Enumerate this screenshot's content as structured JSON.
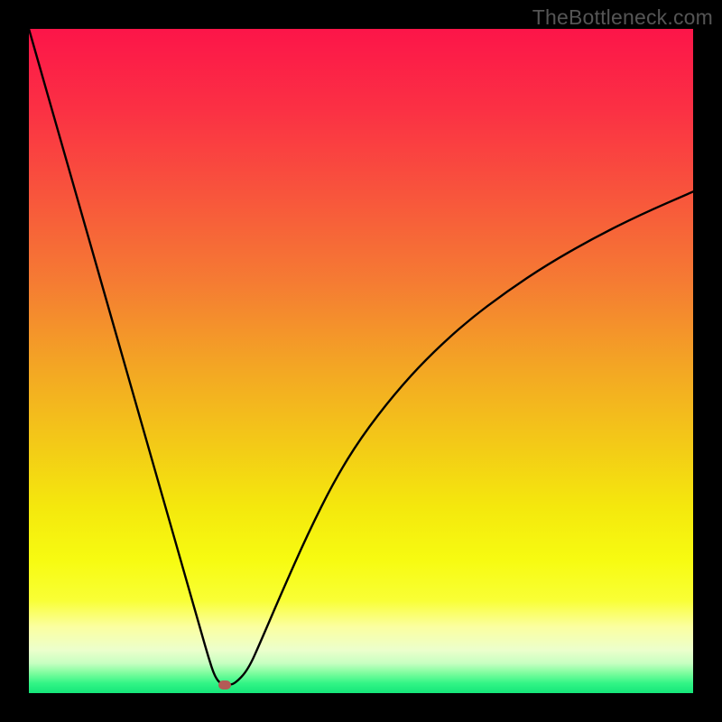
{
  "attribution": "TheBottleneck.com",
  "chart_data": {
    "type": "line",
    "title": "",
    "xlabel": "",
    "ylabel": "",
    "xlim": [
      0,
      100
    ],
    "ylim": [
      0,
      100
    ],
    "grid": false,
    "legend": false,
    "annotations": [],
    "series": [
      {
        "name": "bottleneck-curve",
        "x": [
          0,
          2,
          4,
          6,
          8,
          10,
          12,
          14,
          16,
          18,
          20,
          22,
          24,
          26,
          27,
          28,
          29,
          30,
          31,
          33,
          35,
          38,
          42,
          46,
          50,
          55,
          60,
          66,
          72,
          78,
          85,
          92,
          100
        ],
        "values": [
          100,
          93,
          86,
          79,
          72,
          65,
          58,
          51,
          44,
          37,
          30,
          23,
          16,
          9,
          5.5,
          2.4,
          1.3,
          1.25,
          1.4,
          3.5,
          8,
          15,
          24,
          32,
          38.5,
          45,
          50.5,
          56,
          60.5,
          64.5,
          68.5,
          72,
          75.5
        ],
        "color": "#000000"
      }
    ],
    "marker": {
      "x": 29.5,
      "y": 1.25,
      "color": "#b35a56"
    },
    "background_gradient": {
      "stops": [
        {
          "pos": 0.0,
          "color": "#fc1549"
        },
        {
          "pos": 0.12,
          "color": "#fb3044"
        },
        {
          "pos": 0.25,
          "color": "#f8553c"
        },
        {
          "pos": 0.38,
          "color": "#f57b33"
        },
        {
          "pos": 0.5,
          "color": "#f3a325"
        },
        {
          "pos": 0.62,
          "color": "#f3c818"
        },
        {
          "pos": 0.72,
          "color": "#f4e80d"
        },
        {
          "pos": 0.8,
          "color": "#f7fb11"
        },
        {
          "pos": 0.86,
          "color": "#f9ff35"
        },
        {
          "pos": 0.9,
          "color": "#fbffa0"
        },
        {
          "pos": 0.935,
          "color": "#ecffcc"
        },
        {
          "pos": 0.955,
          "color": "#c7ffc1"
        },
        {
          "pos": 0.97,
          "color": "#7dfd9e"
        },
        {
          "pos": 0.985,
          "color": "#33f586"
        },
        {
          "pos": 1.0,
          "color": "#14e679"
        }
      ]
    }
  }
}
